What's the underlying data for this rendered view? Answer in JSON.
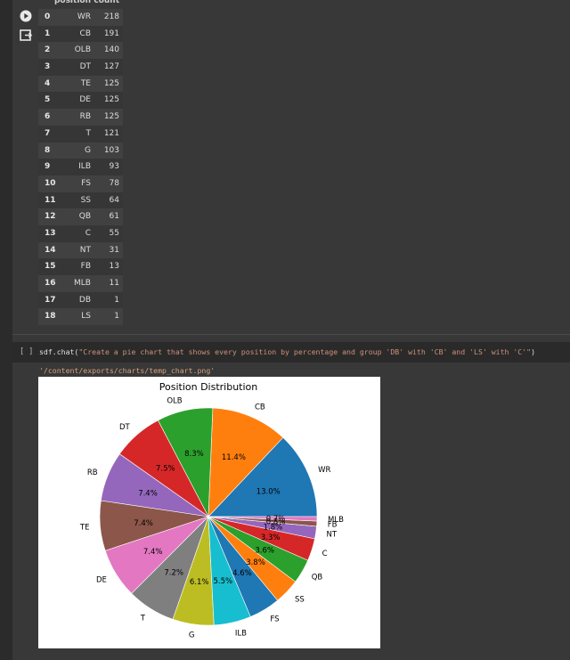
{
  "dataframe": {
    "columns": [
      "position",
      "count"
    ],
    "rows": [
      {
        "idx": "0",
        "position": "WR",
        "count": "218"
      },
      {
        "idx": "1",
        "position": "CB",
        "count": "191"
      },
      {
        "idx": "2",
        "position": "OLB",
        "count": "140"
      },
      {
        "idx": "3",
        "position": "DT",
        "count": "127"
      },
      {
        "idx": "4",
        "position": "TE",
        "count": "125"
      },
      {
        "idx": "5",
        "position": "DE",
        "count": "125"
      },
      {
        "idx": "6",
        "position": "RB",
        "count": "125"
      },
      {
        "idx": "7",
        "position": "T",
        "count": "121"
      },
      {
        "idx": "8",
        "position": "G",
        "count": "103"
      },
      {
        "idx": "9",
        "position": "ILB",
        "count": "93"
      },
      {
        "idx": "10",
        "position": "FS",
        "count": "78"
      },
      {
        "idx": "11",
        "position": "SS",
        "count": "64"
      },
      {
        "idx": "12",
        "position": "QB",
        "count": "61"
      },
      {
        "idx": "13",
        "position": "C",
        "count": "55"
      },
      {
        "idx": "14",
        "position": "NT",
        "count": "31"
      },
      {
        "idx": "15",
        "position": "FB",
        "count": "13"
      },
      {
        "idx": "16",
        "position": "MLB",
        "count": "11"
      },
      {
        "idx": "17",
        "position": "DB",
        "count": "1"
      },
      {
        "idx": "18",
        "position": "LS",
        "count": "1"
      }
    ]
  },
  "code_cell": {
    "run_label": "[ ]",
    "code_prefix": "sdf.chat(",
    "code_string": "\"Create a pie chart that shows every position by percentage and group 'DB' with 'CB' and 'LS' with 'C'\"",
    "code_suffix": ")",
    "output_path": "'/content/exports/charts/temp_chart.png'"
  },
  "icons": {
    "run_output": "play-circle-icon",
    "open_output": "open-output-icon"
  },
  "chart_data": {
    "type": "pie",
    "title": "Position Distribution",
    "categories": [
      "WR",
      "CB",
      "OLB",
      "DT",
      "RB",
      "TE",
      "DE",
      "T",
      "G",
      "ILB",
      "FS",
      "SS",
      "QB",
      "C",
      "NT",
      "FB",
      "MLB"
    ],
    "values": [
      218,
      192,
      140,
      127,
      125,
      125,
      125,
      121,
      103,
      93,
      78,
      64,
      61,
      56,
      31,
      13,
      11
    ],
    "percent_labels": [
      "13.0%",
      "11.4%",
      "8.3%",
      "7.5%",
      "7.4%",
      "7.4%",
      "7.4%",
      "7.2%",
      "6.1%",
      "5.5%",
      "4.6%",
      "3.8%",
      "3.6%",
      "3.3%",
      "1.8%",
      "0.8%",
      "0.7%"
    ],
    "colors": [
      "#1f77b4",
      "#ff7f0e",
      "#2ca02c",
      "#d62728",
      "#9467bd",
      "#8c564b",
      "#e377c2",
      "#7f7f7f",
      "#bcbd22",
      "#17becf",
      "#1f77b4",
      "#ff7f0e",
      "#2ca02c",
      "#d62728",
      "#9467bd",
      "#8c564b",
      "#e377c2"
    ],
    "start_angle_deg": 0,
    "direction": "counterclockwise"
  }
}
